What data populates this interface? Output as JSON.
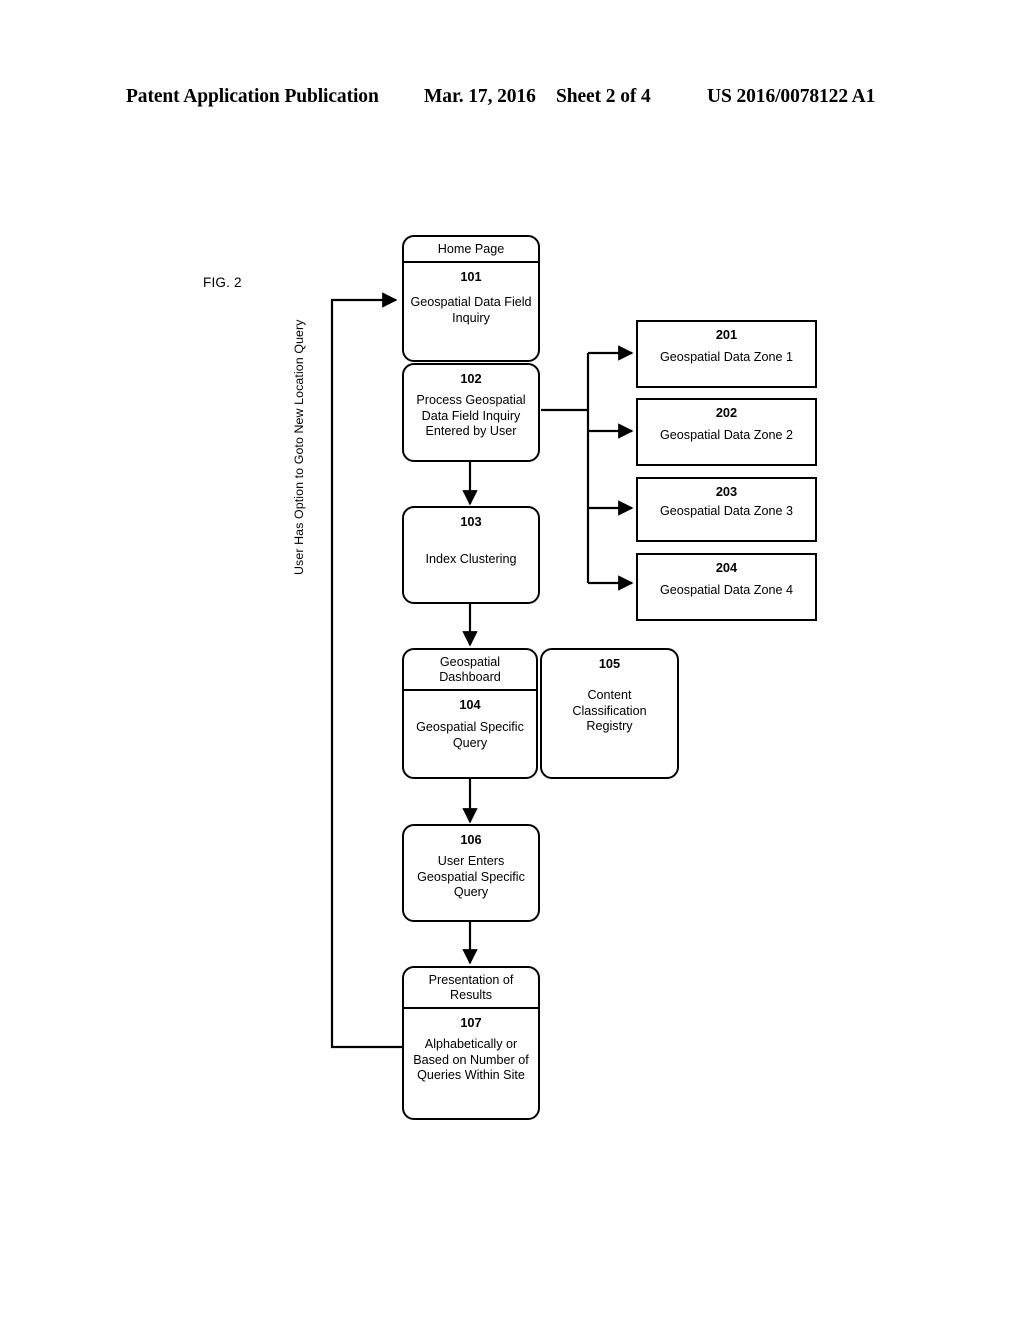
{
  "header": {
    "publication": "Patent Application Publication",
    "date": "Mar. 17, 2016",
    "sheet": "Sheet 2 of 4",
    "number": "US 2016/0078122 A1"
  },
  "figure": {
    "label": "FIG. 2",
    "loop_caption": "User Has Option to Goto New Location Query"
  },
  "flow_nodes": [
    {
      "id": "101",
      "header": "Home Page",
      "text": "Geospatial Data Field Inquiry"
    },
    {
      "id": "102",
      "header": "",
      "text": "Process Geospatial Data Field Inquiry Entered by User"
    },
    {
      "id": "103",
      "header": "",
      "text": "Index Clustering"
    },
    {
      "id": "104",
      "header": "Geospatial Dashboard",
      "text": "Geospatial Specific Query"
    },
    {
      "id": "105",
      "header": "",
      "text": "Content Classification Registry"
    },
    {
      "id": "106",
      "header": "",
      "text": "User Enters Geospatial Specific Query"
    },
    {
      "id": "107",
      "header": "Presentation of Results",
      "text": "Alphabetically or Based on Number of Queries Within Site"
    }
  ],
  "zone_nodes": [
    {
      "id": "201",
      "text": "Geospatial Data Zone 1"
    },
    {
      "id": "202",
      "text": "Geospatial Data Zone 2"
    },
    {
      "id": "203",
      "text": "Geospatial Data Zone 3"
    },
    {
      "id": "204",
      "text": "Geospatial Data Zone 4"
    }
  ],
  "colors": {
    "line": "#000000",
    "background": "#ffffff"
  }
}
